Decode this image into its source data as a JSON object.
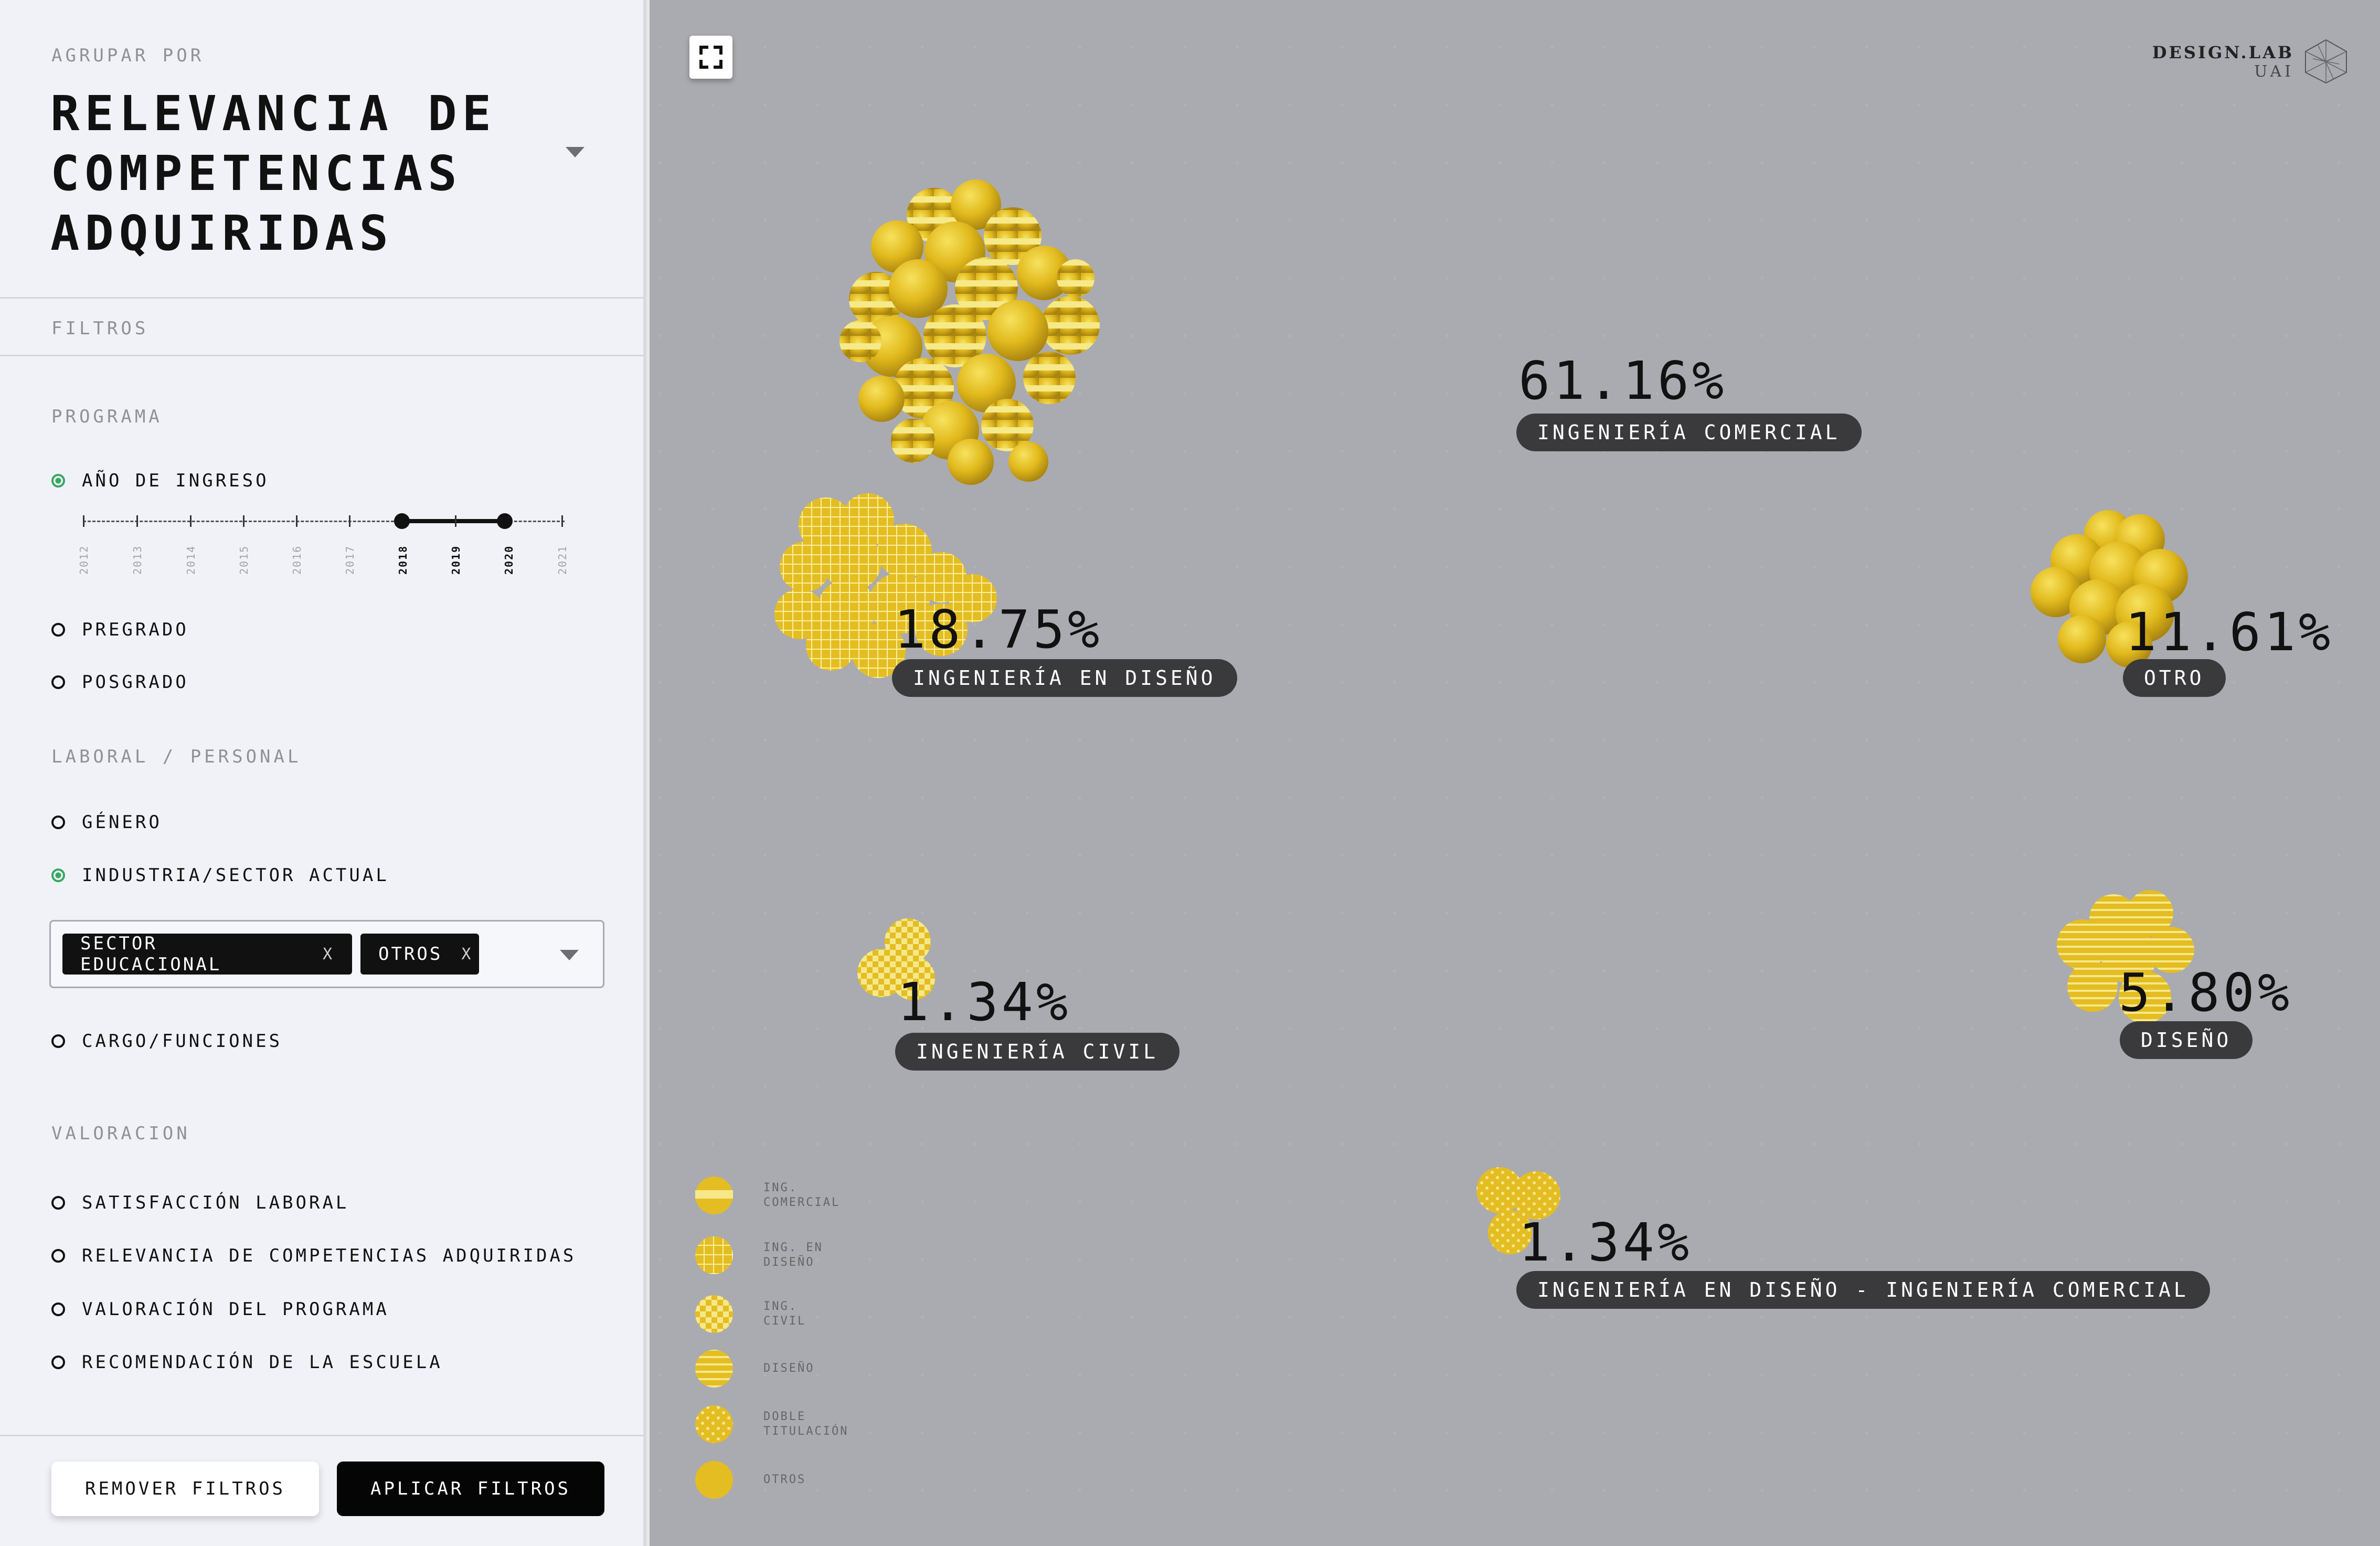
{
  "sidebar": {
    "group_label": "AGRUPAR POR",
    "group_title": "RELEVANCIA DE COMPETENCIAS ADQUIRIDAS",
    "filters_label": "FILTROS",
    "programa_label": "PROGRAMA",
    "anio_ingreso": "AÑO DE INGRESO",
    "years": [
      "2012",
      "2013",
      "2014",
      "2015",
      "2016",
      "2017",
      "2018",
      "2019",
      "2020",
      "2021"
    ],
    "selected_years": [
      "2018",
      "2020"
    ],
    "pregrado": "PREGRADO",
    "posgrado": "POSGRADO",
    "laboral_label": "LABORAL / PERSONAL",
    "genero": "GÉNERO",
    "industria": "INDUSTRIA/SECTOR ACTUAL",
    "chips": [
      "SECTOR EDUCACIONAL",
      "OTROS"
    ],
    "chip_remove": "X",
    "cargo": "CARGO/FUNCIONES",
    "valoracion_label": "VALORACION",
    "satisfaccion": "SATISFACCIÓN LABORAL",
    "relevancia": "RELEVANCIA DE COMPETENCIAS ADQUIRIDAS",
    "valoracion_programa": "VALORACIÓN DEL PROGRAMA",
    "recomendacion": "RECOMENDACIÓN DE LA ESCUELA",
    "remove_button": "REMOVER FILTROS",
    "apply_button": "APLICAR FILTROS"
  },
  "brand": {
    "name": "DESIGN.LAB",
    "sub": "UAI"
  },
  "groups": {
    "comercial": {
      "pct": "61.16%",
      "label": "INGENIERÍA COMERCIAL"
    },
    "diseno_ing": {
      "pct": "18.75%",
      "label": "INGENIERÍA EN DISEÑO"
    },
    "otro": {
      "pct": "11.61%",
      "label": "OTRO"
    },
    "civil": {
      "pct": "1.34%",
      "label": "INGENIERÍA CIVIL"
    },
    "diseno": {
      "pct": "5.80%",
      "label": "DISEÑO"
    },
    "doble": {
      "pct": "1.34%",
      "label": "INGENIERÍA EN DISEÑO - INGENIERÍA COMERCIAL"
    }
  },
  "legend": {
    "comercial": "ING.\nCOMERCIAL",
    "diseno_ing": "ING. EN\nDISEÑO",
    "civil": "ING.\nCIVIL",
    "diseno": "DISEÑO",
    "doble": "DOBLE\nTITULACIÓN",
    "otros": "OTROS"
  },
  "colors": {
    "gold": "#e3bd1c",
    "gold_light": "#f3e27a",
    "accent_green": "#37a860"
  },
  "icons": [
    "fullscreen-icon",
    "chevron-down-icon",
    "close-icon",
    "design-lab-logo-icon"
  ]
}
